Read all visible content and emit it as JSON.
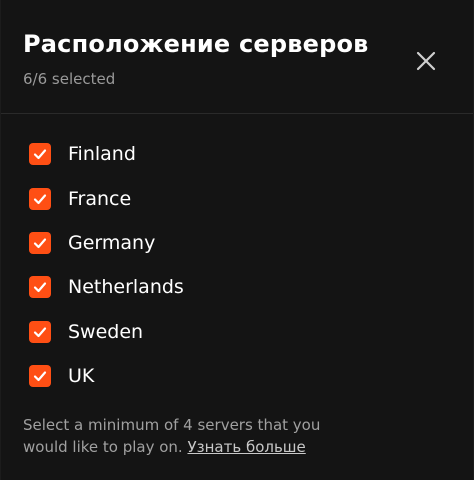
{
  "modal": {
    "title": "Расположение серверов",
    "selection_status": "6/6 selected",
    "close_icon": "close-icon"
  },
  "servers": [
    {
      "label": "Finland",
      "checked": true
    },
    {
      "label": "France",
      "checked": true
    },
    {
      "label": "Germany",
      "checked": true
    },
    {
      "label": "Netherlands",
      "checked": true
    },
    {
      "label": "Sweden",
      "checked": true
    },
    {
      "label": "UK",
      "checked": true
    }
  ],
  "footer": {
    "line1": "Select a minimum of 4 servers that you",
    "line2": "would like to play on.",
    "learn_more": "Узнать больше"
  },
  "colors": {
    "accent": "#ff4f14",
    "background": "#141414",
    "text": "#ffffff",
    "muted_text": "#9a9a9a"
  }
}
